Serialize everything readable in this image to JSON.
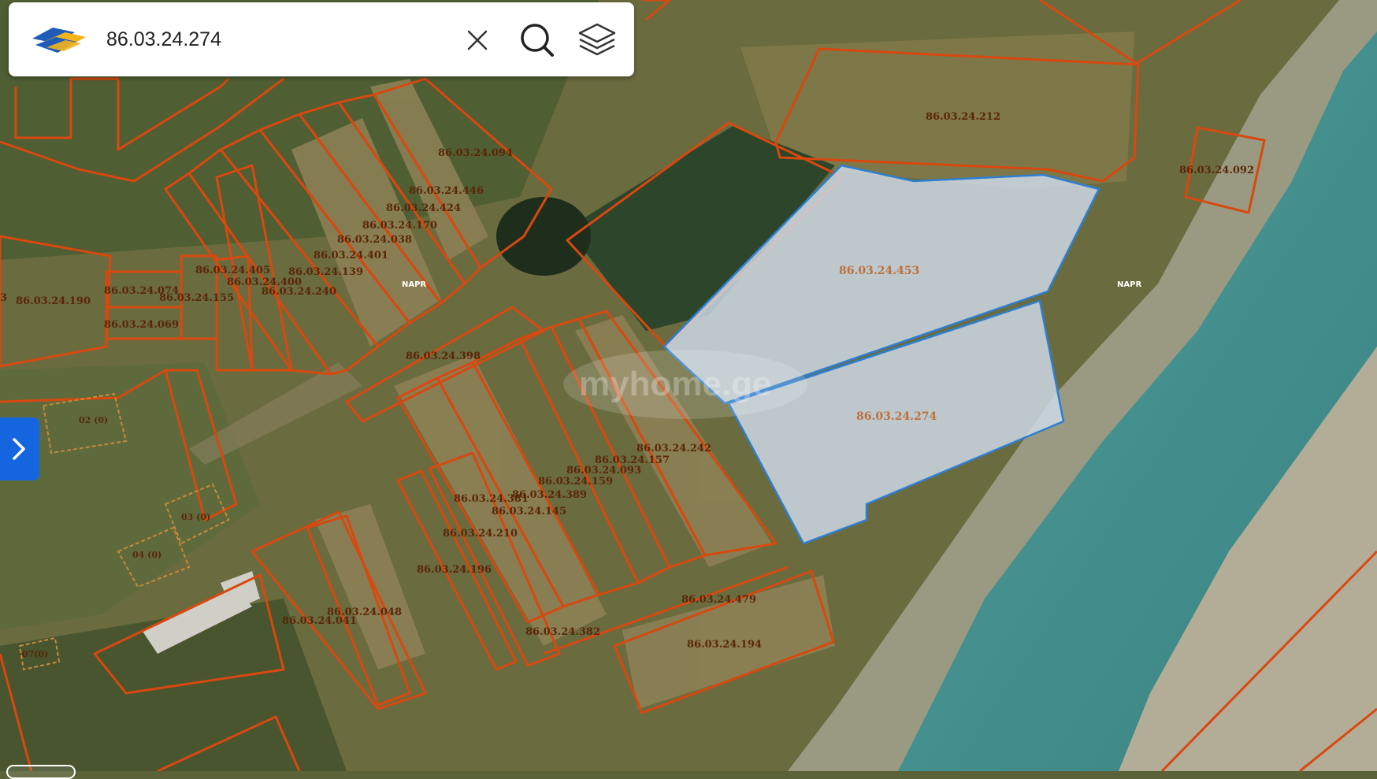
{
  "search": {
    "value": "86.03.24.274"
  },
  "map": {
    "parcels": [
      "86.03.24.212",
      "86.03.24.092",
      "86.03.24.094",
      "86.03.24.446",
      "86.03.24.424",
      "86.03.24.170",
      "86.03.24.038",
      "86.03.24.401",
      "86.03.24.405",
      "86.03.24.139",
      "86.03.24.400",
      "86.03.24.240",
      "86.03.24.074",
      "86.03.24.155",
      "86.03.24.190",
      "86.03.24.069",
      "86.03.24.398",
      "86.03.24.453",
      "86.03.24.274",
      "86.03.24.242",
      "86.03.24.157",
      "86.03.24.093",
      "86.03.24.159",
      "86.03.24.381",
      "86.03.24.389",
      "86.03.24.145",
      "86.03.24.210",
      "86.03.24.196",
      "86.03.24.048",
      "86.03.24.041",
      "86.03.24.479",
      "86.03.24.382",
      "86.03.24.194"
    ],
    "plot_labels": [
      "02 (0)",
      "03 (0)",
      "04 (0)",
      "07(0)"
    ],
    "napr_labels": [
      "NAPR",
      "NAPR"
    ],
    "edge_fragment": "3",
    "watermark": "myhome.ge",
    "colors": {
      "parcel_outline": "#d8480f",
      "highlight_fill": "#cfdceb",
      "highlight_outline": "#2f7fd0",
      "river": "#3f8f8c",
      "accent": "#1565e0"
    }
  },
  "icons": {
    "logo": "napr-logo",
    "clear": "close-icon",
    "search": "search-icon",
    "layers": "layers-icon",
    "toggle": "chevron-right-icon"
  }
}
